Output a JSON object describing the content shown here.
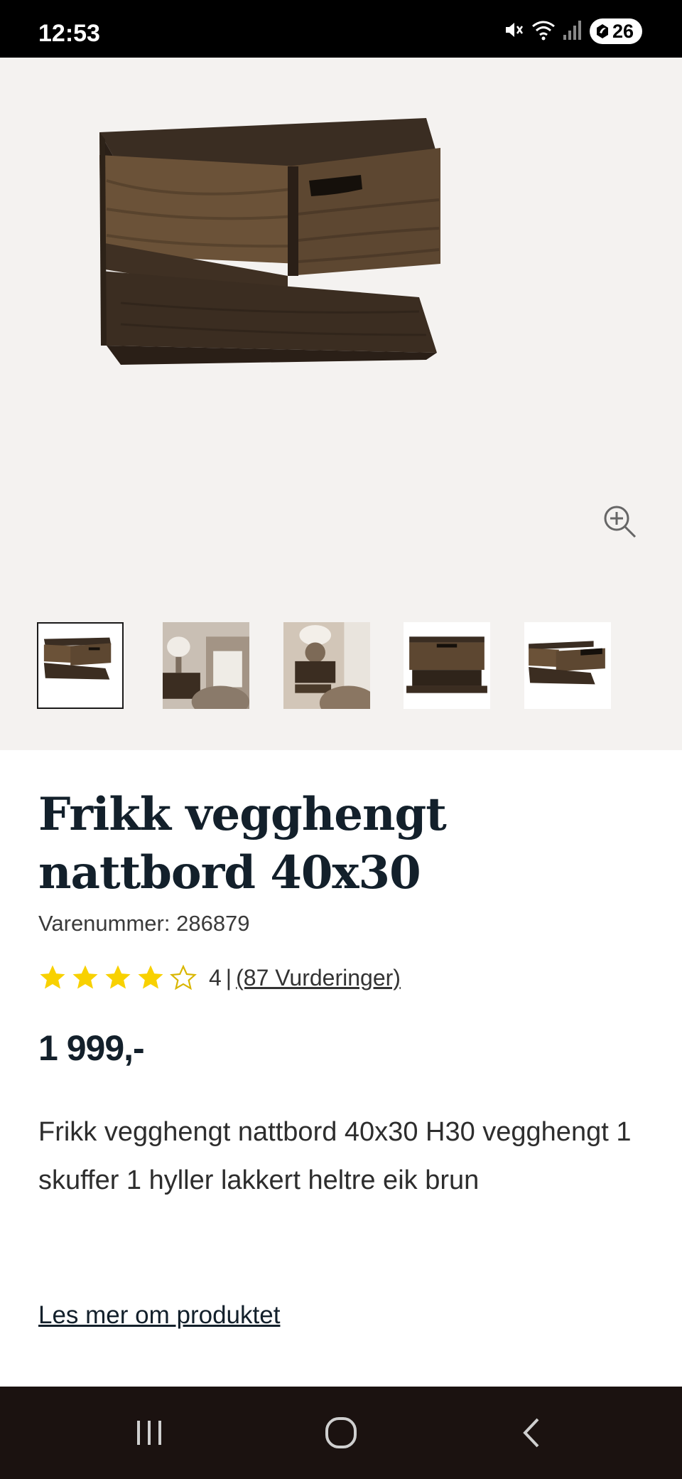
{
  "status_bar": {
    "time": "12:53",
    "battery": "26"
  },
  "product": {
    "title": "Frikk vegghengt nattbord 40x30",
    "sku": "Varenummer: 286879",
    "rating_value": "4",
    "rating_separator": "|",
    "rating_count_text": "(87 Vurderinger)",
    "stars_filled": 4,
    "stars_total": 5,
    "price": "1 999,-",
    "description": "Frikk vegghengt nattbord 40x30 H30 vegghengt 1 skuffer 1 hyller lakkert heltre eik brun",
    "read_more": "Les mer om produktet"
  },
  "gallery": {
    "thumbnail_count": 5,
    "active_thumbnail": 1
  },
  "icons": {
    "mute": "mute-icon",
    "wifi": "wifi-icon",
    "signal": "signal-icon",
    "zoom": "zoom-in-icon",
    "star": "star-icon",
    "recents": "recents-icon",
    "home": "home-icon",
    "back": "back-icon"
  },
  "colors": {
    "heading": "#13202b",
    "gallery_bg": "#f4f2f0",
    "star": "#f8d100",
    "nav_bg": "#1b1210",
    "wood": "#4a3a2a"
  }
}
